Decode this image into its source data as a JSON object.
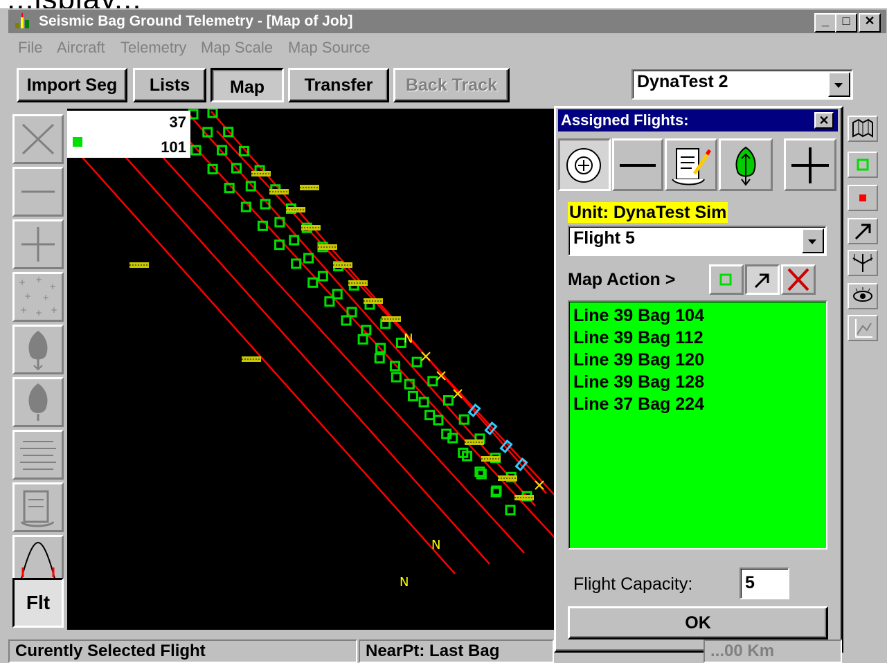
{
  "window": {
    "title": "Seismic Bag Ground Telemetry - [Map of Job]",
    "min": "_",
    "max": "□",
    "close": "✕"
  },
  "top_strip": "...isplay...",
  "menu": [
    "File",
    "Aircraft",
    "Telemetry",
    "Map Scale",
    "Map Source"
  ],
  "toolbar": {
    "import_seg": "Import Seg",
    "lists": "Lists",
    "map": "Map",
    "transfer": "Transfer",
    "back_track": "Back Track",
    "unit_select": "DynaTest 2"
  },
  "left_toolbar": {
    "flt_label": "Flt"
  },
  "legend": {
    "top_value": "37",
    "bottom_value": "101"
  },
  "map": {
    "marker_labels": [
      "N",
      "N",
      "N"
    ],
    "line_color": "#ff0000",
    "bag_color": "#00e000"
  },
  "dialog": {
    "title": "Assigned Flights:",
    "close": "✕",
    "unit_label": "Unit: DynaTest Sim",
    "flight_select": "Flight 5",
    "map_action_label": "Map Action >",
    "bags": [
      "Line 39 Bag 104",
      "Line 39 Bag 112",
      "Line 39 Bag 120",
      "Line 39 Bag 128",
      "Line 37 Bag 224"
    ],
    "capacity_label": "Flight Capacity:",
    "capacity_value": "5",
    "ok": "OK"
  },
  "status": {
    "left": "Curently Selected Flight",
    "middle": "NearPt: Last Bag",
    "right": "...00 Km"
  }
}
